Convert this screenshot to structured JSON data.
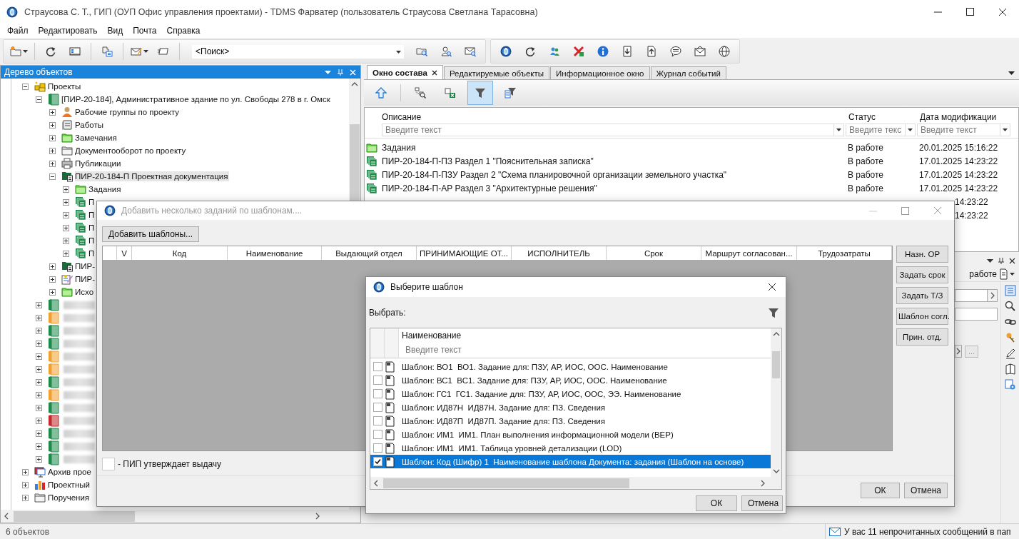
{
  "window": {
    "title": "Страусова С. Т., ГИП (ОУП Офис управления проектами) - TDMS Фарватер (пользователь Страусова Светлана Тарасовна)"
  },
  "menu": [
    "Файл",
    "Редактировать",
    "Вид",
    "Почта",
    "Справка"
  ],
  "search": {
    "value": "<Поиск>"
  },
  "tree_panel": {
    "title": "Дерево объектов",
    "items": [
      {
        "kind": "projects",
        "label": "Проекты",
        "expanded": true,
        "selected": false,
        "children": [
          {
            "kind": "project",
            "color": "#1e8a4a",
            "label": "[ПИР-20-184], Административное здание по ул. Свободы 278 в г. Омск",
            "expanded": true,
            "selected": false,
            "children": [
              {
                "kind": "workgroup",
                "label": "Рабочие группы по проекту",
                "expanded": false,
                "selected": false
              },
              {
                "kind": "works",
                "label": "Работы",
                "expanded": false,
                "selected": false
              },
              {
                "kind": "green-folder",
                "label": "Замечания",
                "expanded": false,
                "selected": false
              },
              {
                "kind": "folder",
                "label": "Документооборот по проекту",
                "expanded": false,
                "selected": false
              },
              {
                "kind": "printer",
                "label": "Публикации",
                "expanded": false,
                "selected": false
              },
              {
                "kind": "doc-folder",
                "label": "ПИР-20-184-П Проектная документация",
                "expanded": true,
                "selected": true,
                "children": [
                  {
                    "kind": "green-folder",
                    "label": "Задания",
                    "expanded": false,
                    "selected": false
                  },
                  {
                    "kind": "section",
                    "label": "П",
                    "expanded": false,
                    "selected": false
                  },
                  {
                    "kind": "section",
                    "label": "П",
                    "expanded": false,
                    "selected": false
                  },
                  {
                    "kind": "section",
                    "label": "П",
                    "expanded": false,
                    "selected": false
                  },
                  {
                    "kind": "section",
                    "label": "П",
                    "expanded": false,
                    "selected": false
                  },
                  {
                    "kind": "section",
                    "label": "П",
                    "expanded": false,
                    "selected": false
                  }
                ]
              },
              {
                "kind": "doc-folder",
                "label": "ПИР-",
                "expanded": false,
                "selected": false
              },
              {
                "kind": "edit",
                "label": "ПИР-",
                "expanded": false,
                "selected": false
              },
              {
                "kind": "green-folder",
                "label": "Исхо",
                "expanded": false,
                "selected": false
              }
            ]
          },
          {
            "kind": "project",
            "color": "#1e8a4a",
            "expanded": false,
            "selected": false
          },
          {
            "kind": "project",
            "color": "#f0a030",
            "expanded": false,
            "selected": false
          },
          {
            "kind": "project",
            "color": "#1e8a4a",
            "expanded": false,
            "selected": false
          },
          {
            "kind": "project",
            "color": "#1e8a4a",
            "expanded": false,
            "selected": false
          },
          {
            "kind": "project",
            "color": "#f0a030",
            "expanded": false,
            "selected": false
          },
          {
            "kind": "project",
            "color": "#f0a030",
            "expanded": false,
            "selected": false
          },
          {
            "kind": "project",
            "color": "#1e8a4a",
            "expanded": false,
            "selected": false
          },
          {
            "kind": "project",
            "color": "#f0a030",
            "expanded": false,
            "selected": false
          },
          {
            "kind": "project",
            "color": "#1e8a4a",
            "expanded": false,
            "selected": false
          },
          {
            "kind": "project",
            "color": "#c0282c",
            "expanded": false,
            "selected": false
          },
          {
            "kind": "project",
            "color": "#1e8a4a",
            "expanded": false,
            "selected": false
          },
          {
            "kind": "project",
            "color": "#1e8a4a",
            "expanded": false,
            "selected": false
          },
          {
            "kind": "project",
            "color": "#1e8a4a",
            "expanded": false,
            "selected": false
          }
        ]
      },
      {
        "kind": "archive",
        "label": "Архив прое",
        "expanded": false,
        "selected": false
      },
      {
        "kind": "chart",
        "label": "Проектный",
        "expanded": false,
        "selected": false
      },
      {
        "kind": "folder",
        "label": "Поручения",
        "expanded": false,
        "selected": false
      }
    ]
  },
  "content_panel": {
    "tabs": [
      {
        "label": "Окно состава",
        "selected": true
      },
      {
        "label": "Редактируемые объекты",
        "selected": false
      },
      {
        "label": "Информационное окно",
        "selected": false
      },
      {
        "label": "Журнал событий",
        "selected": false
      }
    ],
    "toolbar": [
      {
        "kind": "up",
        "selected": false
      },
      {
        "kind": "find",
        "selected": false
      },
      {
        "kind": "export",
        "selected": false
      },
      {
        "kind": "filter",
        "selected": true
      },
      {
        "kind": "filter-table",
        "selected": false
      }
    ],
    "table": {
      "columns": [
        {
          "label": "Описание",
          "placeholder": "Введите текст"
        },
        {
          "label": "Статус",
          "placeholder": "Введите текс"
        },
        {
          "label": "Дата модификации",
          "placeholder": "Введите текст"
        }
      ],
      "rows": [
        {
          "kind": "folder",
          "description": "Задания",
          "status": "В работе",
          "date": "20.01.2025 15:16:22"
        },
        {
          "kind": "section",
          "description": "ПИР-20-184-П-ПЗ Раздел 1 \"Пояснительная записка\"",
          "status": "В работе",
          "date": "17.01.2025 14:23:22"
        },
        {
          "kind": "section",
          "description": "ПИР-20-184-П-ПЗУ Раздел 2 \"Схема планировочной организации земельного участка\"",
          "status": "В работе",
          "date": "17.01.2025 14:23:22"
        },
        {
          "kind": "section",
          "description": "ПИР-20-184-П-АР Раздел 3 \"Архитектурные решения\"",
          "status": "В работе",
          "date": "17.01.2025 14:23:22"
        },
        {
          "kind": "partial",
          "date": "14:23:22"
        },
        {
          "kind": "partial",
          "date": "14:23:22"
        }
      ]
    }
  },
  "side_panel": {
    "status": "работе",
    "browse": "..."
  },
  "dialog_templates": {
    "title": "Добавить несколько заданий по шаблонам....",
    "add_button": "Добавить шаблоны...",
    "columns": [
      "V",
      "Код",
      "Наименование",
      "Выдающий отдел",
      "ПРИНИМАЮЩИЕ ОТ...",
      "ИСПОЛНИТЕЛЬ",
      "Срок",
      "Маршрут согласован...",
      "Трудозатраты"
    ],
    "actions": [
      "Назн. ОР",
      "Задать срок",
      "Задать Т/З",
      "Шаблон согл.",
      "Прин. отд."
    ],
    "approval": {
      "label": "- ПИП утверждает выдачу",
      "checked": false
    },
    "buttons": [
      "ОК",
      "Отмена"
    ]
  },
  "dialog_select": {
    "title": "Выберите шаблон",
    "label": "Выбрать:",
    "column": "Наименование",
    "placeholder": "Введите текст",
    "rows": [
      {
        "label": "Шаблон: ВО1  ВО1. Задание для: ПЗУ, АР, ИОС, ООС. Наименование",
        "checked": false,
        "selected": false
      },
      {
        "label": "Шаблон: ВС1  ВС1. Задание для: ПЗУ, АР, ИОС, ООС. Наименование",
        "checked": false,
        "selected": false
      },
      {
        "label": "Шаблон: ГС1  ГС1. Задание для: ПЗУ, АР, ИОС, ООС, ЭЭ. Наименование",
        "checked": false,
        "selected": false
      },
      {
        "label": "Шаблон: ИД87Н  ИД87Н. Задание для: ПЗ. Сведения",
        "checked": false,
        "selected": false
      },
      {
        "label": "Шаблон: ИД87П  ИД87П. Задание для: ПЗ. Сведения",
        "checked": false,
        "selected": false
      },
      {
        "label": "Шаблон: ИМ1  ИМ1. План выполнения информационной модели (ВЕР)",
        "checked": false,
        "selected": false
      },
      {
        "label": "Шаблон: ИМ1  ИМ1. Таблица уровней детализации (LOD)",
        "checked": false,
        "selected": false
      },
      {
        "label": "Шаблон: Код (Шифр) 1  Наименование шаблона Документа: задания (Шаблон на основе)",
        "checked": true,
        "selected": true
      }
    ],
    "buttons": [
      "ОК",
      "Отмена"
    ]
  },
  "status_bar": {
    "count": "6 объектов",
    "message": "У вас 11 непрочитанных сообщений в пап"
  }
}
